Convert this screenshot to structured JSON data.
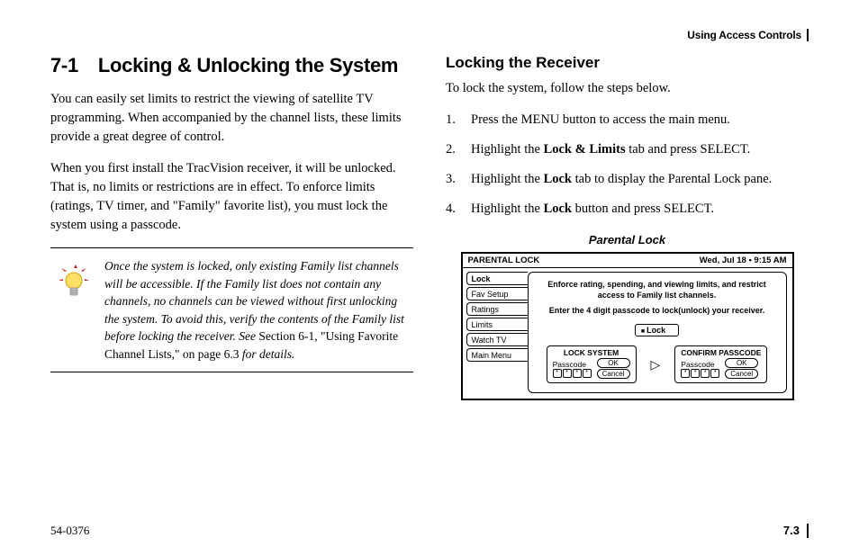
{
  "header": {
    "chapter": "Using Access Controls"
  },
  "left": {
    "section_num": "7-1",
    "section_title": "Locking & Unlocking the System",
    "p1": "You can easily set limits to restrict the viewing of satellite TV programming. When accompanied by the channel lists, these limits provide a great degree of control.",
    "p2": "When you first install the TracVision receiver, it will be unlocked. That is, no limits or restrictions are in effect. To enforce limits (ratings, TV timer, and \"Family\" favorite list), you must lock the system using a passcode.",
    "note_a": "Once the system is locked, only existing Family list channels will be accessible. If the Family list does not contain any channels, no channels can be viewed without first unlocking the system. To avoid this, verify the contents of the Family list before locking the receiver. See ",
    "note_ref": "Section 6-1, \"Using Favorite Channel Lists,\" on page 6.3",
    "note_b": " for details."
  },
  "right": {
    "sub_title": "Locking the Receiver",
    "intro": "To lock the system, follow the steps below.",
    "steps": [
      {
        "pre": "Press the MENU button to access the main menu."
      },
      {
        "pre": "Highlight the ",
        "bold": "Lock & Limits",
        "post": " tab and press SELECT."
      },
      {
        "pre": "Highlight the ",
        "bold": "Lock",
        "post": " tab to display the Parental Lock pane."
      },
      {
        "pre": "Highlight the ",
        "bold": "Lock",
        "post": " button and press SELECT."
      }
    ],
    "figure_caption": "Parental Lock"
  },
  "ui": {
    "title": "PARENTAL LOCK",
    "datetime": "Wed, Jul 18  •  9:15 AM",
    "tabs": [
      "Lock",
      "Fav Setup",
      "Ratings",
      "Limits",
      "Watch TV",
      "Main Menu"
    ],
    "msg1": "Enforce rating, spending, and viewing limits, and restrict access to Family list channels.",
    "msg2": "Enter the 4 digit passcode to lock(unlock) your receiver.",
    "lock_label": "Lock",
    "lock_system": {
      "title": "LOCK SYSTEM",
      "field": "Passcode",
      "ok": "OK",
      "cancel": "Cancel"
    },
    "confirm": {
      "title": "CONFIRM PASSCODE",
      "field": "Passcode",
      "ok": "OK",
      "cancel": "Cancel"
    }
  },
  "footer": {
    "doc": "54-0376",
    "page": "7.3"
  }
}
